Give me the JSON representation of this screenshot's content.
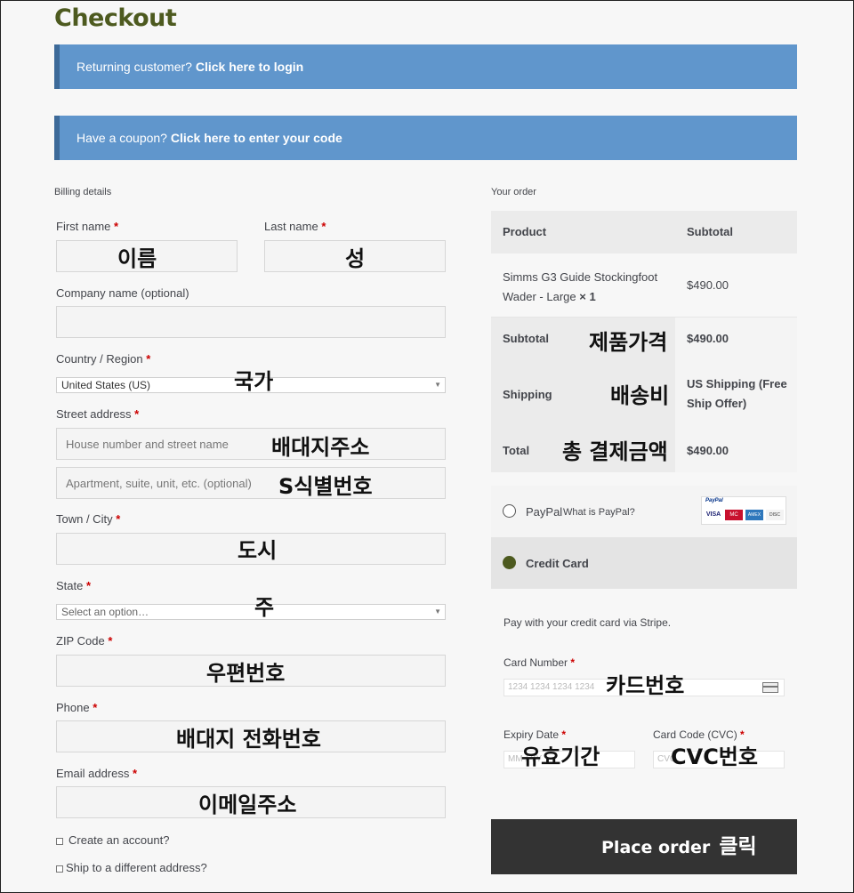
{
  "page_title": "Checkout",
  "notices": {
    "returning": {
      "text": "Returning customer?",
      "link": "Click here to login"
    },
    "coupon": {
      "text": "Have a coupon?",
      "link": "Click here to enter your code"
    }
  },
  "billing": {
    "heading": "Billing details",
    "required_mark": "*",
    "first_name": {
      "label": "First name",
      "annotation": "이름"
    },
    "last_name": {
      "label": "Last name",
      "annotation": "성"
    },
    "company": {
      "label": "Company name (optional)"
    },
    "country": {
      "label": "Country / Region",
      "value": "United States (US)",
      "annotation": "국가"
    },
    "street": {
      "label": "Street address",
      "placeholder1": "House number and street name",
      "annotation1": "배대지주소",
      "placeholder2": "Apartment, suite, unit, etc. (optional)",
      "annotation2": "S식별번호"
    },
    "city": {
      "label": "Town / City",
      "annotation": "도시"
    },
    "state": {
      "label": "State",
      "value": "Select an option…",
      "annotation": "주"
    },
    "zip": {
      "label": "ZIP Code",
      "annotation": "우편번호"
    },
    "phone": {
      "label": "Phone",
      "annotation": "배대지 전화번호"
    },
    "email": {
      "label": "Email address",
      "annotation": "이메일주소"
    },
    "create_account": "Create an account?",
    "ship_different": "Ship to a different address?"
  },
  "order": {
    "heading": "Your order",
    "col_product": "Product",
    "col_subtotal": "Subtotal",
    "item_name_line1": "Simms G3 Guide Stockingfoot",
    "item_name_line2": "Wader - Large",
    "item_qty": "× 1",
    "item_price": "$490.00",
    "subtotal_label": "Subtotal",
    "subtotal_annotation": "제품가격",
    "subtotal_value": "$490.00",
    "shipping_label": "Shipping",
    "shipping_annotation": "배송비",
    "shipping_value_line1": "US Shipping (Free",
    "shipping_value_line2": "Ship Offer)",
    "total_label": "Total",
    "total_annotation": "총 결제금액",
    "total_value": "$490.00"
  },
  "payment": {
    "paypal_label": "PayPal",
    "paypal_link": "What is PayPal?",
    "paypal_logo_text": "PayPal",
    "card_brands": [
      "VISA",
      "MC",
      "AMEX",
      "DISC"
    ],
    "credit_label": "Credit Card",
    "stripe_text": "Pay with your credit card via Stripe.",
    "card_number_label": "Card Number",
    "card_number_placeholder": "1234 1234 1234 1234",
    "card_number_annotation": "카드번호",
    "expiry_label": "Expiry Date",
    "expiry_placeholder": "MM / YY",
    "expiry_annotation": "유효기간",
    "cvc_label": "Card Code (CVC)",
    "cvc_placeholder": "CVC",
    "cvc_annotation": "CVC번호",
    "place_order": "Place order",
    "place_order_annotation": "클릭"
  },
  "colors": {
    "notice_bg": "#6096cc",
    "title": "#4d5a1f",
    "button_bg": "#333333",
    "required": "#cc0000"
  }
}
